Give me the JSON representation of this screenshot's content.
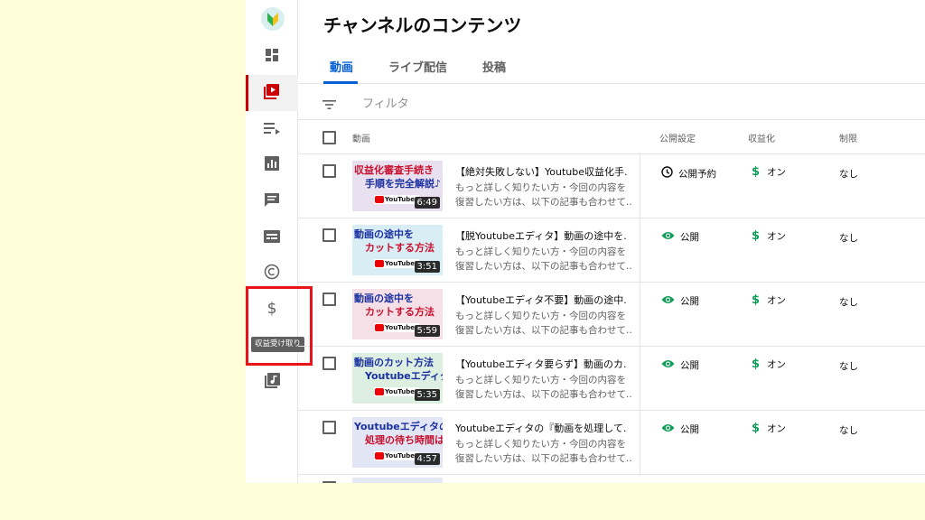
{
  "page_title": "チャンネルのコンテンツ",
  "tabs": [
    {
      "label": "動画",
      "active": true
    },
    {
      "label": "ライブ配信",
      "active": false
    },
    {
      "label": "投稿",
      "active": false
    }
  ],
  "filter": {
    "placeholder": "フィルタ"
  },
  "columns": {
    "video": "動画",
    "visibility": "公開設定",
    "monetization": "収益化",
    "restrictions": "制限"
  },
  "sidebar": {
    "items": [
      {
        "name": "dashboard"
      },
      {
        "name": "content",
        "active": true
      },
      {
        "name": "playlists"
      },
      {
        "name": "analytics"
      },
      {
        "name": "comments"
      },
      {
        "name": "subtitles"
      },
      {
        "name": "copyright"
      },
      {
        "name": "earn"
      },
      {
        "name": "audio-library"
      }
    ],
    "tooltip": "収益受け取り"
  },
  "videos": [
    {
      "thumb_line1": "収益化審査手続き",
      "thumb_line2": "手順を完全解説♪",
      "thumb_bg": "#e8e0ee",
      "thumb_color1": "#c8102e",
      "thumb_color2": "#1a2fa0",
      "duration": "6:49",
      "title": "【絶対失敗しない】Youtube収益化手...",
      "desc1": "もっと詳しく知りたい方・今回の内容を",
      "desc2": "復習したい方は、以下の記事も合わせて...",
      "visibility": "公開予約",
      "visibility_icon": "clock-icon",
      "monetization": "オン",
      "restrictions": "なし"
    },
    {
      "thumb_line1": "動画の途中を",
      "thumb_line2": "カットする方法",
      "thumb_bg": "#d8eef4",
      "thumb_color1": "#1a2fa0",
      "thumb_color2": "#c8102e",
      "duration": "3:51",
      "title": "【脱Youtubeエディタ】動画の途中を...",
      "desc1": "もっと詳しく知りたい方・今回の内容を",
      "desc2": "復習したい方は、以下の記事も合わせて...",
      "visibility": "公開",
      "visibility_icon": "eye-icon",
      "monetization": "オン",
      "restrictions": "なし"
    },
    {
      "thumb_line1": "動画の途中を",
      "thumb_line2": "カットする方法",
      "thumb_bg": "#f4e0e6",
      "thumb_color1": "#1a2fa0",
      "thumb_color2": "#c8102e",
      "duration": "5:59",
      "title": "【Youtubeエディタ不要】動画の途中...",
      "desc1": "もっと詳しく知りたい方・今回の内容を",
      "desc2": "復習したい方は、以下の記事も合わせて...",
      "visibility": "公開",
      "visibility_icon": "eye-icon",
      "monetization": "オン",
      "restrictions": "なし"
    },
    {
      "thumb_line1": "動画のカット方法",
      "thumb_line2": "Youtubeエディタ",
      "thumb_bg": "#dcefe0",
      "thumb_color1": "#1a2fa0",
      "thumb_color2": "#1a2fa0",
      "duration": "5:35",
      "title": "【Youtubeエディタ要らず】動画のカ...",
      "desc1": "もっと詳しく知りたい方・今回の内容を",
      "desc2": "復習したい方は、以下の記事も合わせて...",
      "visibility": "公開",
      "visibility_icon": "eye-icon",
      "monetization": "オン",
      "restrictions": "なし"
    },
    {
      "thumb_line1": "Youtubeエディタの",
      "thumb_line2": "処理の待ち時間は",
      "thumb_bg": "#e2e6f4",
      "thumb_color1": "#1a2fa0",
      "thumb_color2": "#c8102e",
      "duration": "4:57",
      "title": "Youtubeエディタの『動画を処理して...",
      "desc1": "もっと詳しく知りたい方・今回の内容を",
      "desc2": "復習したい方は、以下の記事も合わせて...",
      "visibility": "公開",
      "visibility_icon": "eye-icon",
      "monetization": "オン",
      "restrictions": "なし"
    }
  ],
  "colors": {
    "accent": "#065fd4",
    "highlight": "#e8141a",
    "page_bg": "#fefcd9",
    "money": "#0f9d58"
  }
}
